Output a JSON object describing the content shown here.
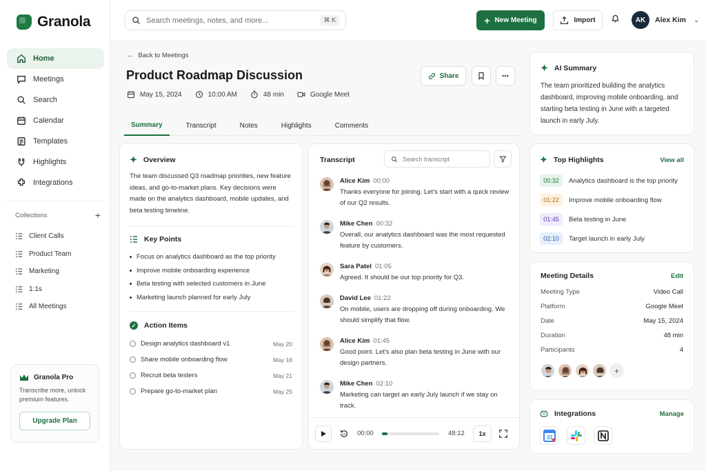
{
  "app": {
    "name": "Granola"
  },
  "sidebar": {
    "items": [
      {
        "label": "Home",
        "icon": "home-icon"
      },
      {
        "label": "Meetings",
        "icon": "chat-icon"
      },
      {
        "label": "Search",
        "icon": "search-icon"
      },
      {
        "label": "Calendar",
        "icon": "calendar-icon"
      },
      {
        "label": "Templates",
        "icon": "template-icon"
      },
      {
        "label": "Highlights",
        "icon": "highlight-icon"
      },
      {
        "label": "Integrations",
        "icon": "integrations-icon"
      }
    ],
    "collections_label": "Collections",
    "collections": [
      "Client Calls",
      "Product Team",
      "Marketing",
      "1:1s",
      "All Meetings"
    ],
    "pro": {
      "title": "Granola Pro",
      "text": "Transcribe more, unlock premium features.",
      "button": "Upgrade Plan"
    }
  },
  "topbar": {
    "search_placeholder": "Search meetings, notes, and more...",
    "shortcut": "⌘ K",
    "new_meeting": "New Meeting",
    "import": "Import",
    "user_initials": "AK",
    "user_name": "Alex Kim"
  },
  "meeting": {
    "back": "Back to Meetings",
    "title": "Product Roadmap Discussion",
    "date": "May 15, 2024",
    "time": "10:00 AM",
    "duration": "48 min",
    "platform": "Google Meet",
    "share": "Share"
  },
  "tabs": [
    "Summary",
    "Transcript",
    "Notes",
    "Highlights",
    "Comments"
  ],
  "overview": {
    "title": "Overview",
    "text": "The team discussed Q3 roadmap priorities, new feature ideas, and go-to-market plans. Key decisions were made on the analytics dashboard, mobile updates, and beta testing timeline.",
    "key_points_title": "Key Points",
    "key_points": [
      "Focus on analytics dashboard as the top priority",
      "Improve mobile onboarding experience",
      "Beta testing with selected customers in June",
      "Marketing launch planned for early July"
    ],
    "action_items_title": "Action Items",
    "action_items": [
      {
        "text": "Design analytics dashboard v1",
        "date": "May 20"
      },
      {
        "text": "Share mobile onboarding flow",
        "date": "May 18"
      },
      {
        "text": "Recruit beta testers",
        "date": "May 21"
      },
      {
        "text": "Prepare go-to-market plan",
        "date": "May 25"
      }
    ]
  },
  "transcript": {
    "title": "Transcript",
    "search_placeholder": "Search transcript",
    "messages": [
      {
        "name": "Alice Kim",
        "time": "00:00",
        "text": "Thanks everyone for joining. Let's start with a quick review of our Q2 results."
      },
      {
        "name": "Mike Chen",
        "time": "00:32",
        "text": "Overall, our analytics dashboard was the most requested feature by customers."
      },
      {
        "name": "Sara Patel",
        "time": "01:05",
        "text": "Agreed. It should be our top priority for Q3."
      },
      {
        "name": "David Lee",
        "time": "01:22",
        "text": "On mobile, users are dropping off during onboarding. We should simplify that flow."
      },
      {
        "name": "Alice Kim",
        "time": "01:45",
        "text": "Good point. Let's also plan beta testing in June with our design partners."
      },
      {
        "name": "Mike Chen",
        "time": "02:10",
        "text": "Marketing can target an early July launch if we stay on track."
      }
    ],
    "player": {
      "current": "00:00",
      "total": "48:12",
      "speed": "1x",
      "progress": 0.1
    }
  },
  "ai_summary": {
    "title": "AI Summary",
    "text": "The team prioritized building the analytics dashboard, improving mobile onboarding, and starting beta testing in June with a targeted launch in early July."
  },
  "highlights": {
    "title": "Top Highlights",
    "view_all": "View all",
    "items": [
      {
        "time": "00:32",
        "text": "Analytics dashboard is the top priority",
        "bg": "#e6f3ea",
        "fg": "#1d6f3e"
      },
      {
        "time": "01:22",
        "text": "Improve mobile onboarding flow",
        "bg": "#fdf1e1",
        "fg": "#b36b12"
      },
      {
        "time": "01:45",
        "text": "Beta testing in June",
        "bg": "#efeafc",
        "fg": "#5b3fb0"
      },
      {
        "time": "02:10",
        "text": "Target launch in early July",
        "bg": "#e6effb",
        "fg": "#2b5aa8"
      }
    ]
  },
  "details": {
    "title": "Meeting Details",
    "edit": "Edit",
    "rows": [
      {
        "label": "Meeting Type",
        "value": "Video Call"
      },
      {
        "label": "Platform",
        "value": "Google Meet"
      },
      {
        "label": "Date",
        "value": "May 15, 2024"
      },
      {
        "label": "Duration",
        "value": "48 min"
      },
      {
        "label": "Participants",
        "value": "4"
      }
    ],
    "add": "+"
  },
  "integrations": {
    "title": "Integrations",
    "manage": "Manage",
    "items": [
      "google-calendar-icon",
      "slack-icon",
      "notion-icon"
    ]
  },
  "colors": {
    "brand": "#1d7140",
    "accent_text": "#1d6f3e"
  }
}
